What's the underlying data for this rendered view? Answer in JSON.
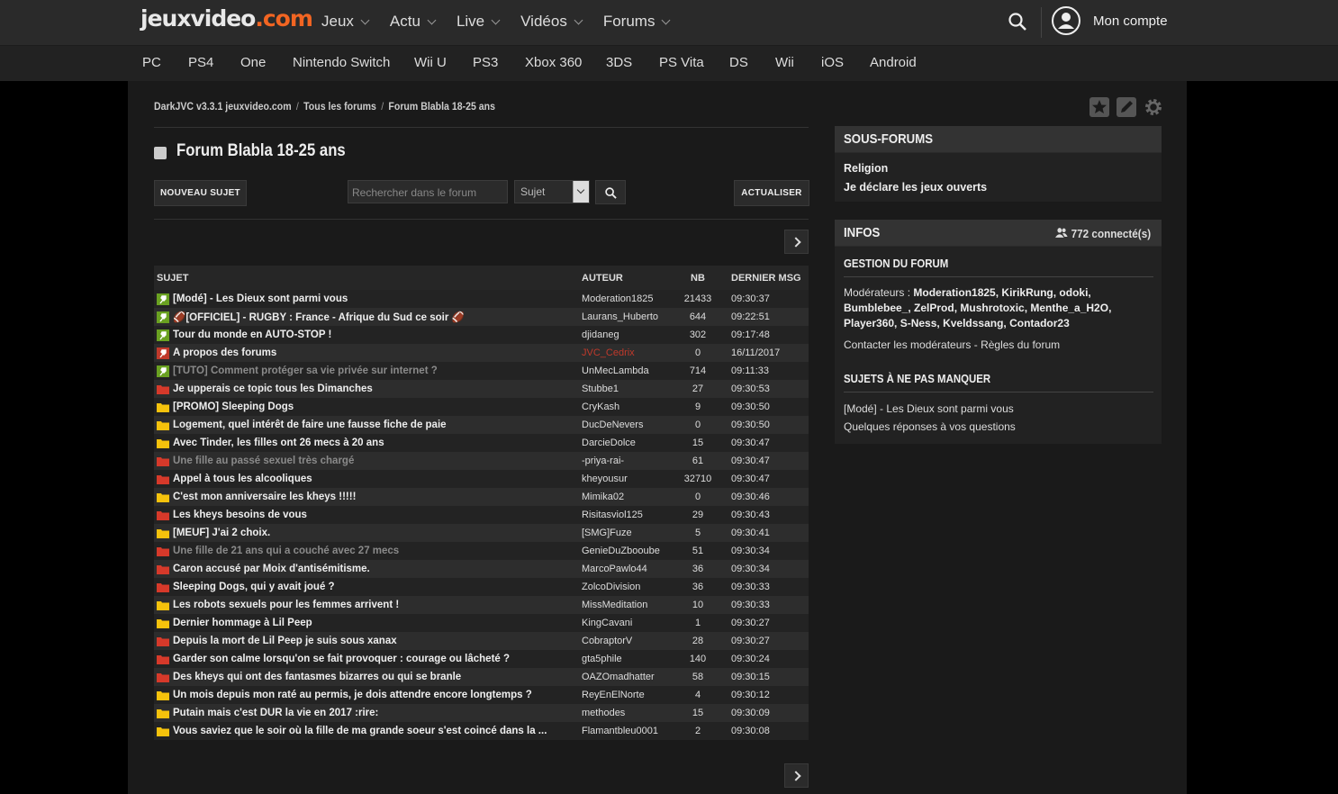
{
  "site": {
    "logo_left": "jeuxvideo",
    "logo_right": ".com"
  },
  "nav": [
    "Jeux",
    "Actu",
    "Live",
    "Vidéos",
    "Forums"
  ],
  "account_label": "Mon compte",
  "platforms": [
    "PC",
    "PS4",
    "One",
    "Nintendo Switch",
    "Wii U",
    "PS3",
    "Xbox 360",
    "3DS",
    "PS Vita",
    "DS",
    "Wii",
    "iOS",
    "Android"
  ],
  "breadcrumb": {
    "ext": "DarkJVC v3.3.1",
    "home": "jeuxvideo.com",
    "forums": "Tous les forums",
    "current": "Forum Blabla 18-25 ans"
  },
  "forum_title": "Forum Blabla 18-25 ans",
  "toolbar": {
    "new_topic": "NOUVEAU SUJET",
    "search_placeholder": "Rechercher dans le forum",
    "select_value": "Sujet",
    "refresh": "ACTUALISER"
  },
  "table": {
    "headers": {
      "subject": "SUJET",
      "author": "AUTEUR",
      "nb": "NB",
      "last": "DERNIER MSG"
    },
    "rows": [
      {
        "icon": "pin-green",
        "subject": "[Modé] - Les Dieux sont parmi vous",
        "author": "Moderation1825",
        "nb": "21433",
        "last": "09:30:37"
      },
      {
        "icon": "pin-green",
        "subject": "🏈[OFFICIEL] - RUGBY : France - Afrique du Sud ce soir 🏈",
        "author": "Laurans_Huberto",
        "nb": "644",
        "last": "09:22:51"
      },
      {
        "icon": "pin-green",
        "subject": "Tour du monde en AUTO-STOP !",
        "author": "djidaneg",
        "nb": "302",
        "last": "09:17:48"
      },
      {
        "icon": "pin-red",
        "subject": "A propos des forums",
        "author": "JVC_Cedrix",
        "author_red": true,
        "nb": "0",
        "last": "16/11/2017"
      },
      {
        "icon": "pin-green",
        "subject": "[TUTO] Comment protéger sa vie privée sur internet ?",
        "grey": true,
        "author": "UnMecLambda",
        "nb": "714",
        "last": "09:11:33"
      },
      {
        "icon": "folder-red",
        "subject": "Je upperais ce topic tous les Dimanches",
        "author": "Stubbe1",
        "nb": "27",
        "last": "09:30:53"
      },
      {
        "icon": "folder-yellow",
        "subject": "[PROMO] Sleeping Dogs",
        "author": "CryKash",
        "nb": "9",
        "last": "09:30:50"
      },
      {
        "icon": "folder-yellow",
        "subject": "Logement, quel intérêt de faire une fausse fiche de paie",
        "author": "DucDeNevers",
        "nb": "0",
        "last": "09:30:50"
      },
      {
        "icon": "folder-yellow",
        "subject": "Avec Tinder, les filles ont 26 mecs à 20 ans",
        "author": "DarcieDolce",
        "nb": "15",
        "last": "09:30:47"
      },
      {
        "icon": "folder-red",
        "subject": "Une fille au passé sexuel très chargé",
        "grey": true,
        "author": "-priya-rai-",
        "nb": "61",
        "last": "09:30:47"
      },
      {
        "icon": "folder-red",
        "subject": "Appel à tous les alcooliques",
        "author": "kheyousur",
        "nb": "32710",
        "last": "09:30:47"
      },
      {
        "icon": "folder-yellow",
        "subject": "C'est mon anniversaire les kheys !!!!!",
        "author": "Mimika02",
        "nb": "0",
        "last": "09:30:46"
      },
      {
        "icon": "folder-red",
        "subject": "Les kheys besoins de vous",
        "author": "Risitasviol125",
        "nb": "29",
        "last": "09:30:43"
      },
      {
        "icon": "folder-yellow",
        "subject": "[MEUF] J'ai 2 choix.",
        "author": "[SMG]Fuze",
        "nb": "5",
        "last": "09:30:41"
      },
      {
        "icon": "folder-red",
        "subject": "Une fille de 21 ans qui a couché avec 27 mecs",
        "grey": true,
        "author": "GenieDuZbooube",
        "nb": "51",
        "last": "09:30:34"
      },
      {
        "icon": "folder-red",
        "subject": "Caron accusé par Moix d'antisémitisme.",
        "author": "MarcoPawlo44",
        "nb": "36",
        "last": "09:30:34"
      },
      {
        "icon": "folder-red",
        "subject": "Sleeping Dogs, qui y avait joué ?",
        "author": "ZolcoDivision",
        "nb": "36",
        "last": "09:30:33"
      },
      {
        "icon": "folder-yellow",
        "subject": "Les robots sexuels pour les femmes arrivent !",
        "author": "MissMeditation",
        "nb": "10",
        "last": "09:30:33"
      },
      {
        "icon": "folder-yellow",
        "subject": "Dernier hommage à Lil Peep",
        "author": "KingCavani",
        "nb": "1",
        "last": "09:30:27"
      },
      {
        "icon": "folder-red",
        "subject": "Depuis la mort de Lil Peep je suis sous xanax",
        "author": "CobraptorV",
        "nb": "28",
        "last": "09:30:27"
      },
      {
        "icon": "folder-red",
        "subject": "Garder son calme lorsqu'on se fait provoquer : courage ou lâcheté ?",
        "author": "gta5phile",
        "nb": "140",
        "last": "09:30:24"
      },
      {
        "icon": "folder-red",
        "subject": "Des kheys qui ont des fantasmes bizarres ou qui se branle",
        "author": "OAZOmadhatter",
        "nb": "58",
        "last": "09:30:15"
      },
      {
        "icon": "folder-yellow",
        "subject": "Un mois depuis mon raté au permis, je dois attendre encore longtemps ?",
        "author": "ReyEnElNorte",
        "nb": "4",
        "last": "09:30:12"
      },
      {
        "icon": "folder-yellow",
        "subject": "Putain mais c'est DUR la vie en 2017 :rire:",
        "author": "methodes",
        "nb": "15",
        "last": "09:30:09"
      },
      {
        "icon": "folder-yellow",
        "subject": "Vous saviez que le soir où la fille de ma grande soeur s'est coincé dans la ...",
        "author": "Flamantbleu0001",
        "nb": "2",
        "last": "09:30:08"
      }
    ]
  },
  "sidebar": {
    "subforums_title": "SOUS-FORUMS",
    "subforums": [
      "Religion",
      "Je déclare les jeux ouverts"
    ],
    "infos_title": "INFOS",
    "connected": "772 connecté(s)",
    "gestion_title": "GESTION DU FORUM",
    "moderators_label": "Modérateurs : ",
    "moderators": "Moderation1825, KirikRung, odoki, Bumblebee_, ZelProd, Mushrotoxic, Menthe_a_H2O, Player360, S-Ness, Kveldssang, Contador23",
    "contact": "Contacter les modérateurs",
    "rules": "Règles du forum",
    "dash": " - ",
    "must_see_title": "SUJETS À NE PAS MANQUER",
    "must_see": [
      "[Modé] - Les Dieux sont parmi vous",
      "Quelques réponses à vos questions"
    ]
  },
  "colors": {
    "accent": "#f26522",
    "pin_green": "#6aa121",
    "pin_red": "#c0392b",
    "folder_red": "#d63a2a",
    "folder_yellow": "#f4c20d"
  }
}
